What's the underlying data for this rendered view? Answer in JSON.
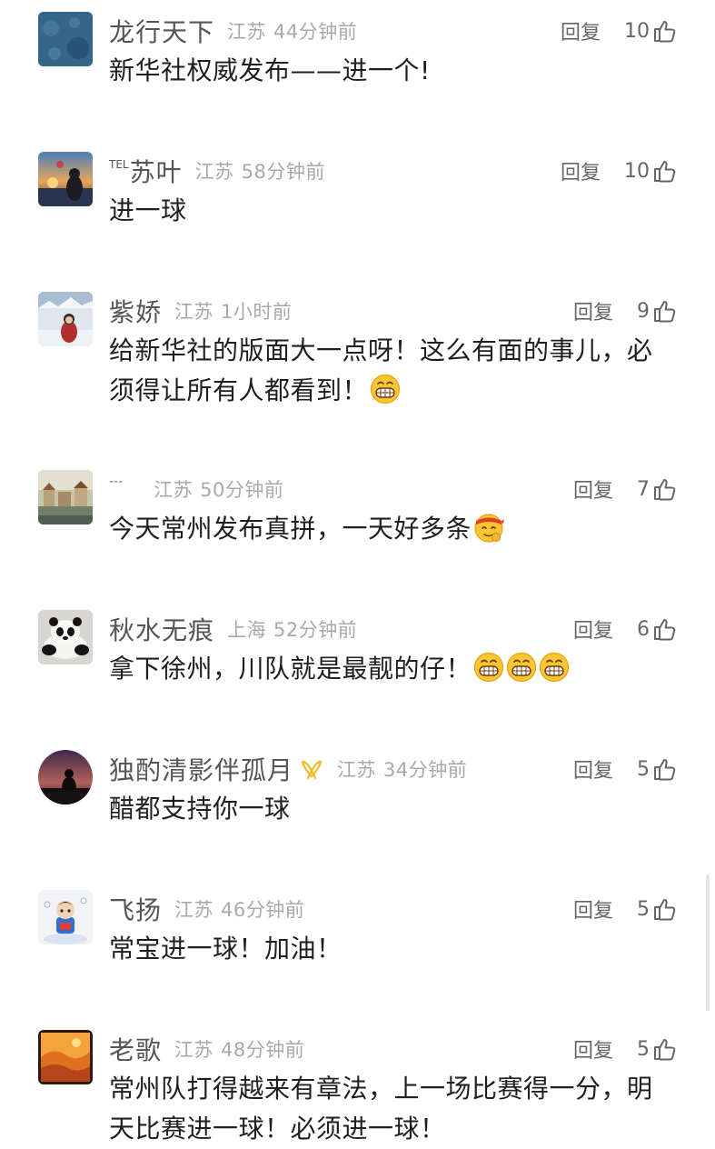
{
  "reply_label": "回复",
  "comments": [
    {
      "nickname": "龙行天下",
      "location": "江苏",
      "time": "44分钟前",
      "likes": "10",
      "text": "新华社权威发布——进一个!",
      "avatar_icon": "blue-texture-avatar"
    },
    {
      "nickname_prefix": "TEL",
      "nickname": "苏叶",
      "location": "江苏",
      "time": "58分钟前",
      "likes": "10",
      "text": "进一球",
      "avatar_icon": "sunset-person-avatar"
    },
    {
      "nickname": "紫娇",
      "location": "江苏",
      "time": "1小时前",
      "likes": "9",
      "text": "给新华社的版面大一点呀！这么有面的事儿，必须得让所有人都看到！",
      "emojis": [
        "grin-emoji"
      ],
      "avatar_icon": "snow-person-avatar"
    },
    {
      "nickname": "---",
      "location": "江苏",
      "time": "50分钟前",
      "likes": "7",
      "text": "今天常州发布真拼，一天好多条",
      "emojis": [
        "headband-emoji"
      ],
      "avatar_icon": "town-painting-avatar"
    },
    {
      "nickname": "秋水无痕",
      "location": "上海",
      "time": "52分钟前",
      "likes": "6",
      "text": "拿下徐州，川队就是最靓的仔！",
      "emojis": [
        "grin-emoji",
        "grin-emoji",
        "grin-emoji"
      ],
      "avatar_icon": "panda-avatar"
    },
    {
      "nickname": "独酌清影伴孤月",
      "location": "江苏",
      "time": "34分钟前",
      "likes": "5",
      "text": "醋都支持你一球",
      "badge": "yellow-ribbon-badge",
      "avatar_icon": "dusk-silhouette-avatar"
    },
    {
      "nickname": "飞扬",
      "location": "江苏",
      "time": "46分钟前",
      "likes": "5",
      "text": "常宝进一球！加油！",
      "avatar_icon": "cartoon-child-avatar"
    },
    {
      "nickname": "老歌",
      "location": "江苏",
      "time": "48分钟前",
      "likes": "5",
      "text": "常州队打得越来有章法，上一场比赛得一分，明天比赛进一球！必须进一球！",
      "avatar_icon": "orange-landscape-avatar"
    }
  ]
}
